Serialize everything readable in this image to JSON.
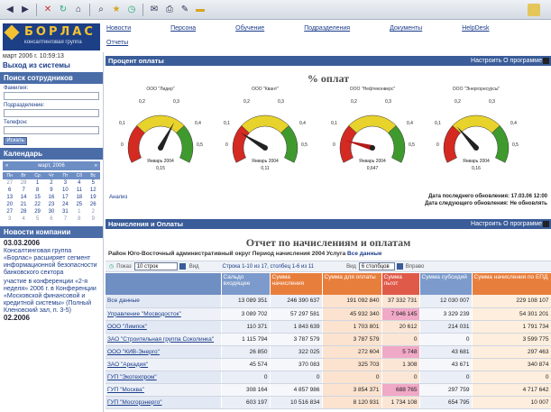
{
  "browser": {
    "icons": [
      "back-icon",
      "forward-icon",
      "stop-icon",
      "refresh-icon",
      "home-icon",
      "search-icon",
      "favorites-icon",
      "history-icon",
      "mail-icon",
      "print-icon",
      "edit-icon",
      "folder-icon"
    ]
  },
  "header": {
    "logo_name": "БОРЛАС",
    "logo_sub": "консалтинговая группа",
    "nav": [
      "Новости",
      "Персона",
      "Обучение",
      "Подразделения",
      "Документы",
      "HelpDesk"
    ],
    "nav2": "Отчеты"
  },
  "sidebar": {
    "date": "март 2006 г. 10:59:13",
    "logout": "Выход из системы",
    "search_head": "Поиск сотрудников",
    "search_fields": [
      "Фамилия:",
      "Подразделение:",
      "Телефон:"
    ],
    "search_button": "Искать",
    "calendar_head": "Календарь",
    "calendar_month": "март, 2006",
    "calendar_days": [
      "Пн",
      "Вт",
      "Ср",
      "Чт",
      "Пт",
      "Сб",
      "Вс"
    ],
    "calendar_weeks": [
      [
        "27",
        "28",
        "1",
        "2",
        "3",
        "4",
        "5"
      ],
      [
        "6",
        "7",
        "8",
        "9",
        "10",
        "11",
        "12"
      ],
      [
        "13",
        "14",
        "15",
        "16",
        "17",
        "18",
        "19"
      ],
      [
        "20",
        "21",
        "22",
        "23",
        "24",
        "25",
        "26"
      ],
      [
        "27",
        "28",
        "29",
        "30",
        "31",
        "1",
        "2"
      ],
      [
        "3",
        "4",
        "5",
        "6",
        "7",
        "8",
        "9"
      ]
    ],
    "news_head": "Новости компании",
    "news_date1": "03.03.2006",
    "news_text1": "Консалтинговая группа «Борлас» расширяет сегмент информационной безопасности банковского сектора",
    "news_text2": "участие в конференции «2-я неделя» 2006 г. в Конференции «Московской финансовой и кредитной системы» (Полный Кленовский зал, п. 3-5)",
    "news_date2": "02.2006"
  },
  "gauges_panel": {
    "bar_title": "Процент оплаты",
    "bar_right": "Настроить   О программе",
    "title": "% оплат",
    "gauges": [
      {
        "title": "ООО \"Лидер\"",
        "value_text": "0,15",
        "caption": "Январь 2004"
      },
      {
        "title": "ООО \"Квант\"",
        "value_text": "0,11",
        "caption": "Январь 2004"
      },
      {
        "title": "ООО \"Нефтеконверс\"",
        "value_text": "0,647",
        "caption": "Январь 2004"
      },
      {
        "title": "ООО \"Энергоресурсы\"",
        "value_text": "0,16",
        "caption": "Январь 2004"
      }
    ],
    "scale_labels": {
      "zero": "0",
      "low": "0,1",
      "mid1": "0,2",
      "mid2": "0,3",
      "high": "0,4",
      "max": "0,5"
    },
    "help": "Анализ",
    "update_line1": "Дата последнего обновления: 17.03.06 12:00",
    "update_line2": "Дата следующего обновления: Не обновлять"
  },
  "report_panel": {
    "bar_title": "Начисления и Оплаты",
    "bar_right": "Настроить   О программе",
    "title": "Отчет по начислениям и оплатам",
    "filter_text": "Район Юго-Восточный административный округ   Период начисления 2004   Услуга",
    "filter_value": "Все данные",
    "pager": {
      "left_label": "Показ",
      "rows_select": "10 строк",
      "mode_label": "Вид",
      "range_text": "Строка 1-10 из 17, столбец 1-6 из 11",
      "col_label": "Вид",
      "col_select": "6 столбцов",
      "right_label": "Вправо"
    },
    "columns": [
      "",
      "Сальдо входящее",
      "Сумма начисления",
      "Сумма для оплаты",
      "Сумма льгот",
      "Сумма субсидий",
      "Сумма начисления по ЕПД"
    ],
    "header_colors": [
      "#6f8ec2",
      "#7c9acb",
      "#e87e3c",
      "#e87e3c",
      "#e05a4a",
      "#7c9acb",
      "#e87e3c"
    ],
    "rows": [
      {
        "name": "Все данные",
        "total": true,
        "cells": [
          "13 089 351",
          "246 390 637",
          "191 092 840",
          "37 332 731",
          "12 030 007",
          "229 108 107"
        ]
      },
      {
        "name": "Управление \"Мосводосток\"",
        "cells": [
          "3 089 702",
          "57 297 581",
          "45 932 340",
          "7 946 145",
          "3 329 239",
          "54 301 201"
        ]
      },
      {
        "name": "ООО \"Лимпок\"",
        "cells": [
          "110 371",
          "1 843 639",
          "1 703 801",
          "20 612",
          "214 031",
          "1 791 734"
        ]
      },
      {
        "name": "ЗАО \"Строительная группа Соколинка\"",
        "cells": [
          "1 115 794",
          "3 787 579",
          "3 787 579",
          "0",
          "0",
          "3 599 775"
        ]
      },
      {
        "name": "ООО \"КИВ-Энерго\"",
        "cells": [
          "26 850",
          "322 025",
          "272 604",
          "5 748",
          "43 681",
          "297 463"
        ]
      },
      {
        "name": "ЗАО \"Аркадия\"",
        "cells": [
          "45 574",
          "370 083",
          "325 703",
          "1 308",
          "43 671",
          "340 874"
        ]
      },
      {
        "name": "ГУП \"Экотехпром\"",
        "cells": [
          "0",
          "0",
          "0",
          "0",
          "0",
          "0"
        ]
      },
      {
        "name": "ГУП \"Москва\"",
        "cells": [
          "308 164",
          "4 857 986",
          "3 854 371",
          "688 765",
          "297 759",
          "4 717 642"
        ]
      },
      {
        "name": "ГУП \"Мосгорэнерго\"",
        "cells": [
          "603 197",
          "10 516 834",
          "8 120 931",
          "1 734 108",
          "654 795",
          "10 007"
        ]
      }
    ]
  },
  "colors": {
    "accent": "#3a5d99",
    "gauge_red": "#d42a22",
    "gauge_yellow": "#e8d22c",
    "gauge_green": "#3f9a2e"
  }
}
